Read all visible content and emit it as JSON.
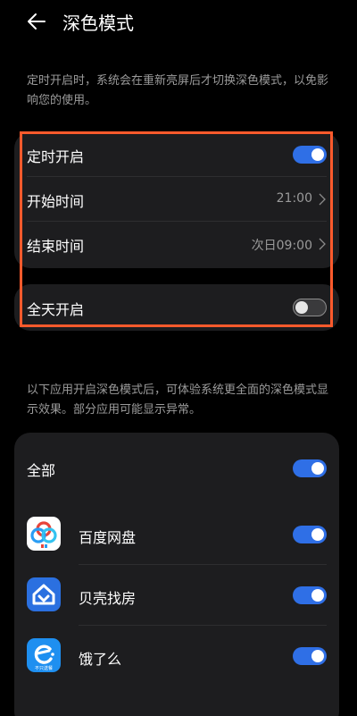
{
  "header": {
    "title": "深色模式",
    "back_icon": "arrow-left-icon"
  },
  "schedule_description": "定时开启时，系统会在重新亮屏后才切换深色模式，以免影响您的使用。",
  "schedule": {
    "enable_label": "定时开启",
    "enable_on": true,
    "start_label": "开始时间",
    "start_value": "21:00",
    "end_label": "结束时间",
    "end_value": "次日09:00"
  },
  "all_day": {
    "label": "全天开启",
    "on": false
  },
  "apps_description": "以下应用开启深色模式后，可体验系统更全面的深色模式显示效果。部分应用可能显示异常。",
  "apps": {
    "all_label": "全部",
    "all_on": true,
    "items": [
      {
        "name": "百度网盘",
        "icon": "baidu-netdisk-icon",
        "on": true
      },
      {
        "name": "贝壳找房",
        "icon": "beike-icon",
        "on": true
      },
      {
        "name": "饿了么",
        "icon": "eleme-icon",
        "icon_text": "不只送餐",
        "on": true
      }
    ]
  },
  "colors": {
    "accent": "#2f6fe6",
    "highlight": "#ff5a2c",
    "card": "#1d1d1f"
  }
}
